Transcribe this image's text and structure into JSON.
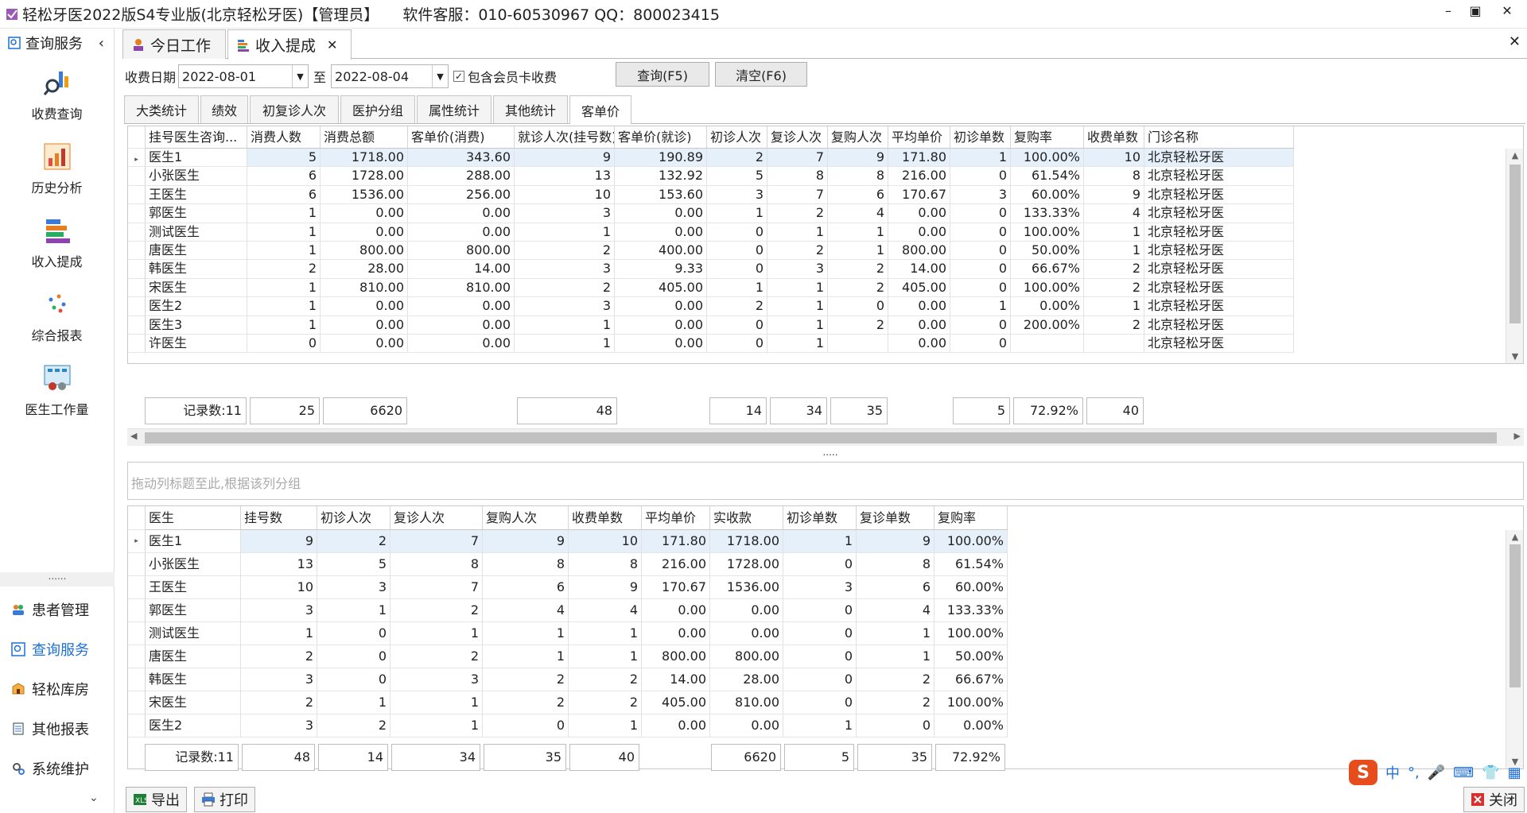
{
  "titlebar": {
    "title": "轻松牙医2022版S4专业版(北京轻松牙医)【管理员】",
    "support": "软件客服：010-60530967 QQ：800023415",
    "min": "–",
    "max": "▣",
    "close": "✕"
  },
  "sidebar": {
    "header": "查询服务",
    "collapse": "‹",
    "big_items": [
      {
        "label": "收费查询"
      },
      {
        "label": "历史分析"
      },
      {
        "label": "收入提成"
      },
      {
        "label": "综合报表"
      },
      {
        "label": "医生工作量"
      }
    ],
    "dots": "......",
    "modules": [
      {
        "label": "患者管理"
      },
      {
        "label": "查询服务"
      },
      {
        "label": "轻松库房"
      },
      {
        "label": "其他报表"
      },
      {
        "label": "系统维护"
      }
    ],
    "chevron": "⌄"
  },
  "tabs": [
    {
      "label": "今日工作"
    },
    {
      "label": "收入提成",
      "close": "✕"
    }
  ],
  "close_all": "✕",
  "filter": {
    "date_label": "收费日期",
    "date_from": "2022-08-01",
    "to_label": "至",
    "date_to": "2022-08-04",
    "checkbox_label": "包含会员卡收费",
    "check_mark": "✓",
    "query_button": "查询(F5)",
    "clear_button": "清空(F6)"
  },
  "subtabs": [
    "大类统计",
    "绩效",
    "初复诊人次",
    "医护分组",
    "属性统计",
    "其他统计",
    "客单价"
  ],
  "top_grid": {
    "headers": [
      "挂号医生咨询...",
      "消费人数",
      "消费总额",
      "客单价(消费)",
      "就诊人次(挂号数)",
      "客单价(就诊)",
      "初诊人次",
      "复诊人次",
      "复购人次",
      "平均单价",
      "初诊单数",
      "复购率",
      "收费单数",
      "门诊名称"
    ],
    "rows": [
      [
        "医生1",
        "5",
        "1718.00",
        "343.60",
        "9",
        "190.89",
        "2",
        "7",
        "9",
        "171.80",
        "1",
        "100.00%",
        "10",
        "北京轻松牙医"
      ],
      [
        "小张医生",
        "6",
        "1728.00",
        "288.00",
        "13",
        "132.92",
        "5",
        "8",
        "8",
        "216.00",
        "0",
        "61.54%",
        "8",
        "北京轻松牙医"
      ],
      [
        "王医生",
        "6",
        "1536.00",
        "256.00",
        "10",
        "153.60",
        "3",
        "7",
        "6",
        "170.67",
        "3",
        "60.00%",
        "9",
        "北京轻松牙医"
      ],
      [
        "郭医生",
        "1",
        "0.00",
        "0.00",
        "3",
        "0.00",
        "1",
        "2",
        "4",
        "0.00",
        "0",
        "133.33%",
        "4",
        "北京轻松牙医"
      ],
      [
        "测试医生",
        "1",
        "0.00",
        "0.00",
        "1",
        "0.00",
        "0",
        "1",
        "1",
        "0.00",
        "0",
        "100.00%",
        "1",
        "北京轻松牙医"
      ],
      [
        "唐医生",
        "1",
        "800.00",
        "800.00",
        "2",
        "400.00",
        "0",
        "2",
        "1",
        "800.00",
        "0",
        "50.00%",
        "1",
        "北京轻松牙医"
      ],
      [
        "韩医生",
        "2",
        "28.00",
        "14.00",
        "3",
        "9.33",
        "0",
        "3",
        "2",
        "14.00",
        "0",
        "66.67%",
        "2",
        "北京轻松牙医"
      ],
      [
        "宋医生",
        "1",
        "810.00",
        "810.00",
        "2",
        "405.00",
        "1",
        "1",
        "2",
        "405.00",
        "0",
        "100.00%",
        "2",
        "北京轻松牙医"
      ],
      [
        "医生2",
        "1",
        "0.00",
        "0.00",
        "3",
        "0.00",
        "2",
        "1",
        "0",
        "0.00",
        "1",
        "0.00%",
        "1",
        "北京轻松牙医"
      ],
      [
        "医生3",
        "1",
        "0.00",
        "0.00",
        "1",
        "0.00",
        "0",
        "1",
        "2",
        "0.00",
        "0",
        "200.00%",
        "2",
        "北京轻松牙医"
      ],
      [
        "许医生",
        "0",
        "0.00",
        "0.00",
        "1",
        "0.00",
        "0",
        "1",
        "",
        "0.00",
        "0",
        "",
        "",
        "北京轻松牙医"
      ]
    ],
    "footer": {
      "count": "记录数:11",
      "consumers": "25",
      "total": "6620",
      "visits": "48",
      "first": "14",
      "repeat": "34",
      "rebuy": "35",
      "first_orders": "5",
      "rate": "72.92%",
      "orders": "40"
    }
  },
  "splitter": ".....",
  "group_hint": "拖动列标题至此,根据该列分组",
  "bottom_grid": {
    "headers": [
      "医生",
      "挂号数",
      "初诊人次",
      "复诊人次",
      "复购人次",
      "收费单数",
      "平均单价",
      "实收款",
      "初诊单数",
      "复诊单数",
      "复购率"
    ],
    "rows": [
      [
        "医生1",
        "9",
        "2",
        "7",
        "9",
        "10",
        "171.80",
        "1718.00",
        "1",
        "9",
        "100.00%"
      ],
      [
        "小张医生",
        "13",
        "5",
        "8",
        "8",
        "8",
        "216.00",
        "1728.00",
        "0",
        "8",
        "61.54%"
      ],
      [
        "王医生",
        "10",
        "3",
        "7",
        "6",
        "9",
        "170.67",
        "1536.00",
        "3",
        "6",
        "60.00%"
      ],
      [
        "郭医生",
        "3",
        "1",
        "2",
        "4",
        "4",
        "0.00",
        "0.00",
        "0",
        "4",
        "133.33%"
      ],
      [
        "测试医生",
        "1",
        "0",
        "1",
        "1",
        "1",
        "0.00",
        "0.00",
        "0",
        "1",
        "100.00%"
      ],
      [
        "唐医生",
        "2",
        "0",
        "2",
        "1",
        "1",
        "800.00",
        "800.00",
        "0",
        "1",
        "50.00%"
      ],
      [
        "韩医生",
        "3",
        "0",
        "3",
        "2",
        "2",
        "14.00",
        "28.00",
        "0",
        "2",
        "66.67%"
      ],
      [
        "宋医生",
        "2",
        "1",
        "1",
        "2",
        "2",
        "405.00",
        "810.00",
        "0",
        "2",
        "100.00%"
      ],
      [
        "医生2",
        "3",
        "2",
        "1",
        "0",
        "1",
        "0.00",
        "0.00",
        "1",
        "0",
        "0.00%"
      ]
    ],
    "footer": {
      "count": "记录数:11",
      "reg": "48",
      "first": "14",
      "repeat": "34",
      "rebuy": "35",
      "orders": "40",
      "paid": "6620",
      "first_orders": "5",
      "repeat_orders": "35",
      "rate": "72.92%"
    }
  },
  "bottom": {
    "export": "导出",
    "print": "打印",
    "close": "关闭"
  },
  "ime": {
    "logo": "S",
    "lang": "中",
    "punct": "°,",
    "mic": "🎤",
    "kbd": "⌨",
    "skin": "👕",
    "grid": "▦"
  },
  "scroll_arrows": {
    "up": "▲",
    "down": "▼",
    "left": "◀",
    "right": "▶"
  },
  "row_marker": "▸"
}
